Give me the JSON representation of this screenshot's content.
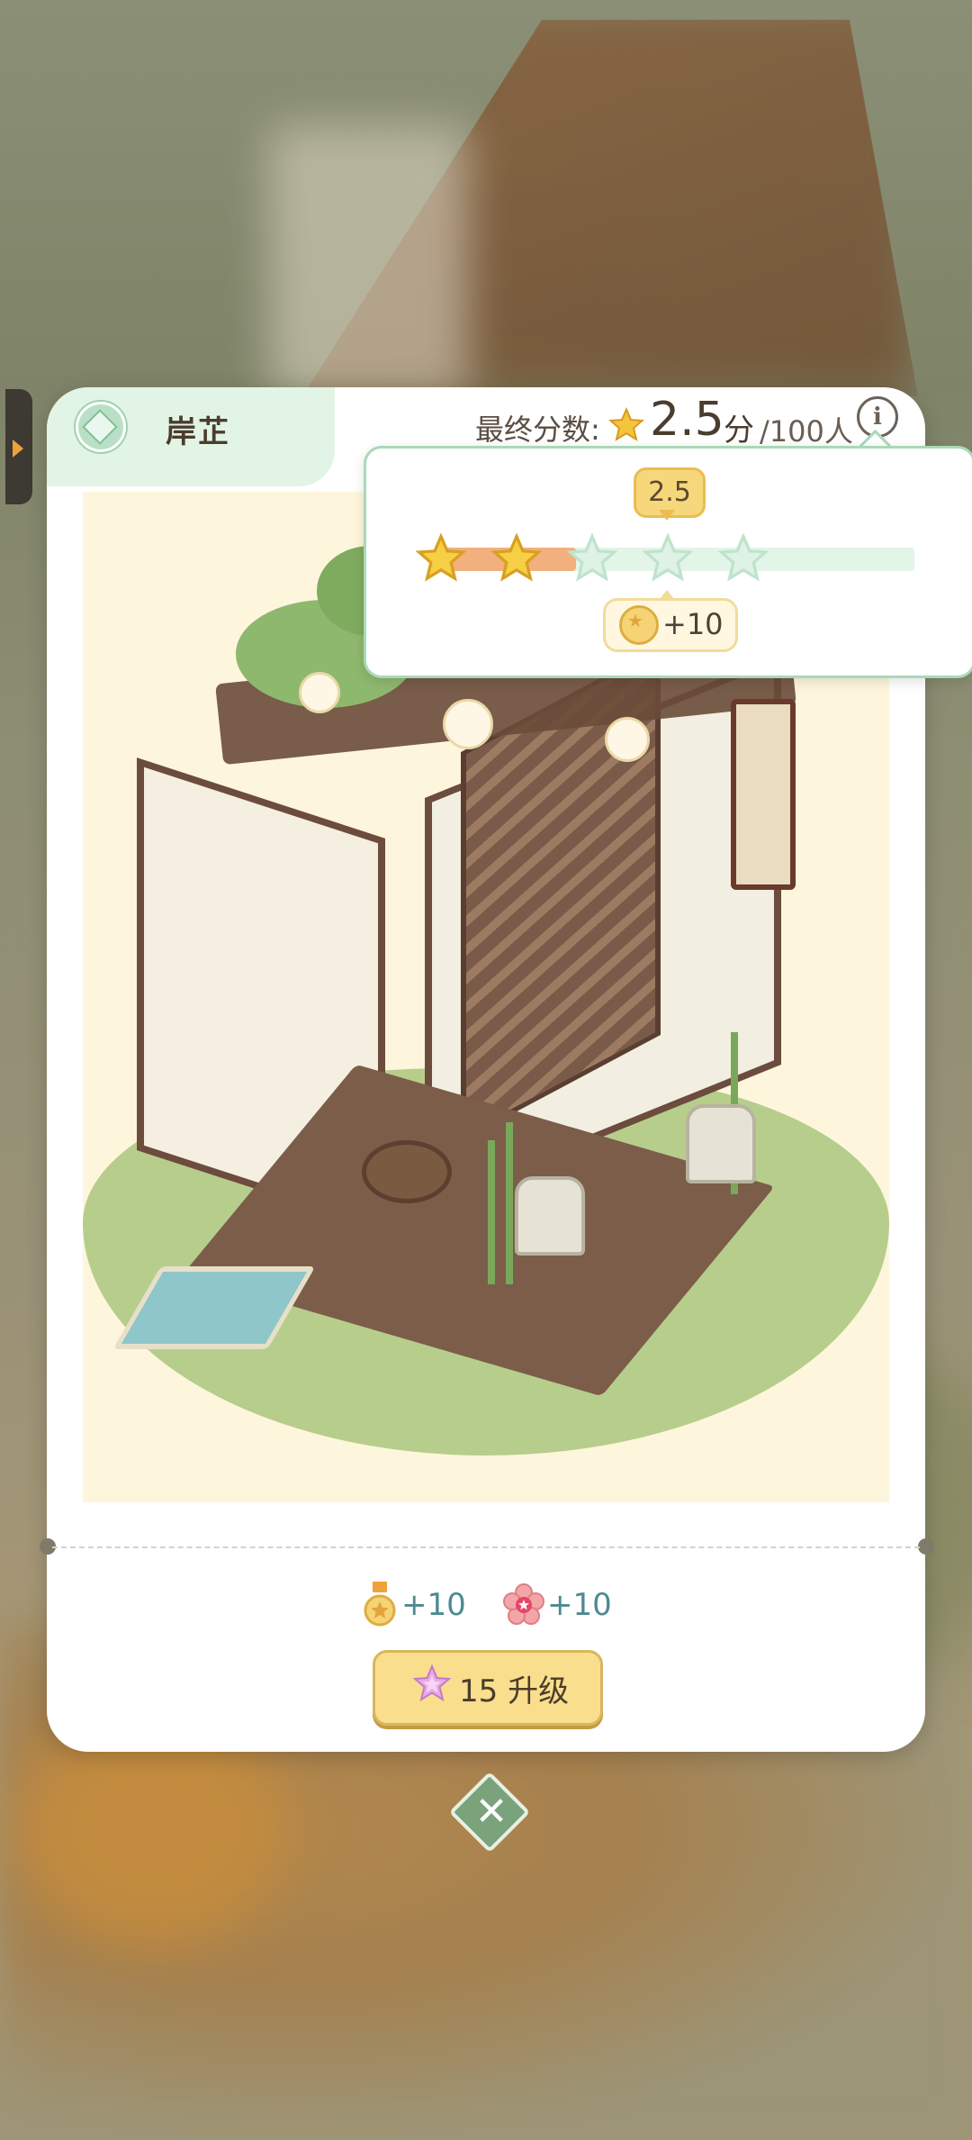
{
  "room": {
    "title": "岸芷"
  },
  "score": {
    "label": "最终分数:",
    "value": "2.5",
    "unit": "分",
    "people": "/100人",
    "info_icon": "i"
  },
  "rating_popup": {
    "current_rating": "2.5",
    "rating_value": 2.5,
    "max_rating": 5,
    "reward_text": "+10"
  },
  "rewards": {
    "medal_text": "+10",
    "flower_text": "+10"
  },
  "upgrade": {
    "cost": "15",
    "label": "15 升级"
  },
  "icons": {
    "close": "close-icon",
    "star": "star-icon",
    "medal": "medal-icon",
    "flower": "flower-icon",
    "gem": "gem-icon"
  },
  "colors": {
    "accent_green": "#a9d9b7",
    "star_gold": "#f2c53d",
    "progress_fill": "#f2b07e",
    "button_yellow": "#f9df8d",
    "reward_teal": "#4d8a91"
  }
}
